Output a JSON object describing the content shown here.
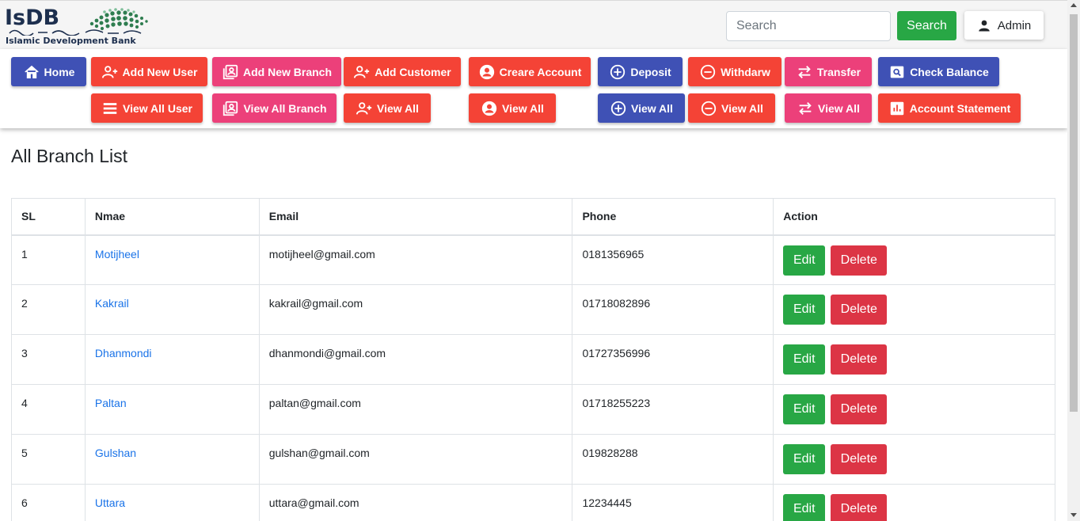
{
  "header": {
    "logo_text": "IsDB",
    "logo_subtitle": "Islamic Development Bank",
    "search_placeholder": "Search",
    "search_button": "Search",
    "admin_label": "Admin"
  },
  "nav": {
    "home": "Home",
    "add_new_user": "Add New User",
    "add_new_branch": "Add New Branch",
    "add_customer": "Add Customer",
    "create_account": "Creare Account",
    "deposit": "Deposit",
    "withdraw": "Withdarw",
    "transfer": "Transfer",
    "check_balance": "Check Balance",
    "view_all_user": "View All User",
    "view_all_branch": "View All Branch",
    "view_all_customer": "View All",
    "view_all_account": "View All",
    "view_all_deposit": "View All",
    "view_all_withdraw": "View All",
    "view_all_transfer": "View All",
    "account_statement": "Account Statement"
  },
  "colors": {
    "indigo": "#3f51b5",
    "red": "#f44336",
    "pink": "#ec407a",
    "success": "#28a745",
    "danger": "#dc3545",
    "link": "#1a73e8"
  },
  "main": {
    "title": "All Branch List",
    "columns": [
      "SL",
      "Nmae",
      "Email",
      "Phone",
      "Action"
    ],
    "edit_label": "Edit",
    "delete_label": "Delete",
    "rows": [
      {
        "sl": "1",
        "name": "Motijheel",
        "email": "motijheel@gmail.com",
        "phone": "0181356965"
      },
      {
        "sl": "2",
        "name": "Kakrail",
        "email": "kakrail@gmail.com",
        "phone": "01718082896"
      },
      {
        "sl": "3",
        "name": "Dhanmondi",
        "email": "dhanmondi@gmail.com",
        "phone": "01727356996"
      },
      {
        "sl": "4",
        "name": "Paltan",
        "email": "paltan@gmail.com",
        "phone": "01718255223"
      },
      {
        "sl": "5",
        "name": "Gulshan",
        "email": "gulshan@gmail.com",
        "phone": "019828288"
      },
      {
        "sl": "6",
        "name": "Uttara",
        "email": "uttara@gmail.com",
        "phone": "12234445"
      }
    ]
  }
}
